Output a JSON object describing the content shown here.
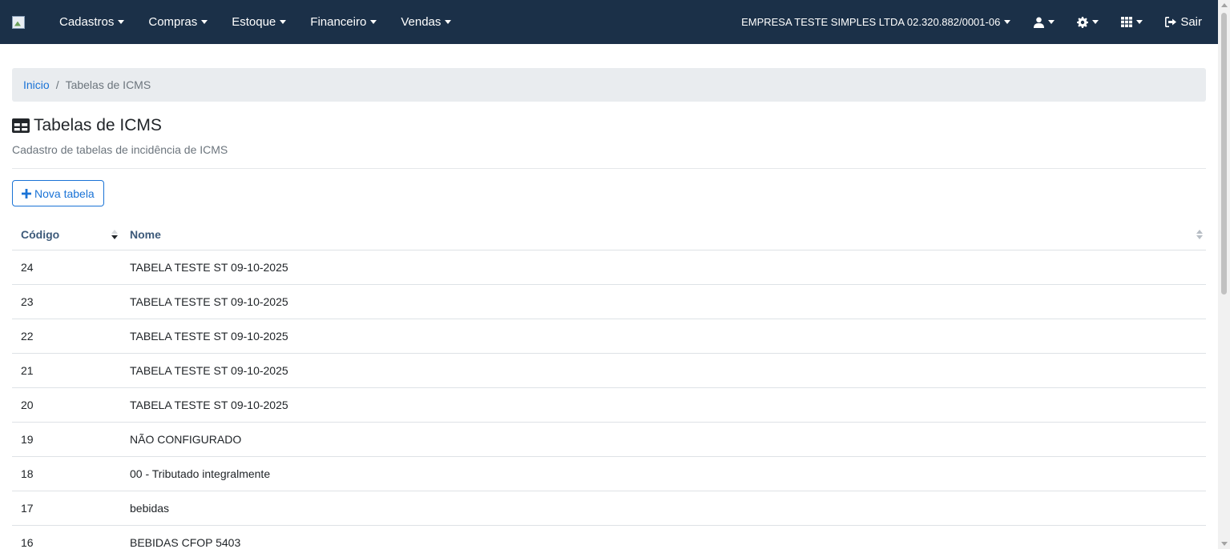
{
  "navbar": {
    "logo_alt": "logo",
    "menus": [
      {
        "label": "Cadastros"
      },
      {
        "label": "Compras"
      },
      {
        "label": "Estoque"
      },
      {
        "label": "Financeiro"
      },
      {
        "label": "Vendas"
      }
    ],
    "company": "EMPRESA TESTE SIMPLES LTDA 02.320.882/0001-06",
    "logout_label": "Sair",
    "icons": [
      "user-icon",
      "gear-icon",
      "grid-icon",
      "sign-out-icon"
    ],
    "bg_color": "#1b3048"
  },
  "breadcrumb": {
    "home": "Inicio",
    "current": "Tabelas de ICMS"
  },
  "page": {
    "title": "Tabelas de ICMS",
    "subtitle": "Cadastro de tabelas de incidência de ICMS",
    "new_button": "Nova tabela",
    "title_icon": "table-icon"
  },
  "table": {
    "columns": [
      "Código",
      "Nome"
    ],
    "sort": {
      "column": "Código",
      "direction": "desc"
    },
    "rows": [
      {
        "code": "24",
        "name": "TABELA TESTE ST 09-10-2025"
      },
      {
        "code": "23",
        "name": "TABELA TESTE ST 09-10-2025"
      },
      {
        "code": "22",
        "name": "TABELA TESTE ST 09-10-2025"
      },
      {
        "code": "21",
        "name": "TABELA TESTE ST 09-10-2025"
      },
      {
        "code": "20",
        "name": "TABELA TESTE ST 09-10-2025"
      },
      {
        "code": "19",
        "name": "NÃO CONFIGURADO"
      },
      {
        "code": "18",
        "name": "00 - Tributado integralmente"
      },
      {
        "code": "17",
        "name": "bebidas"
      },
      {
        "code": "16",
        "name": "BEBIDAS CFOP 5403"
      }
    ]
  },
  "colors": {
    "accent": "#1a73d6",
    "header_text": "#3d5a7a"
  }
}
